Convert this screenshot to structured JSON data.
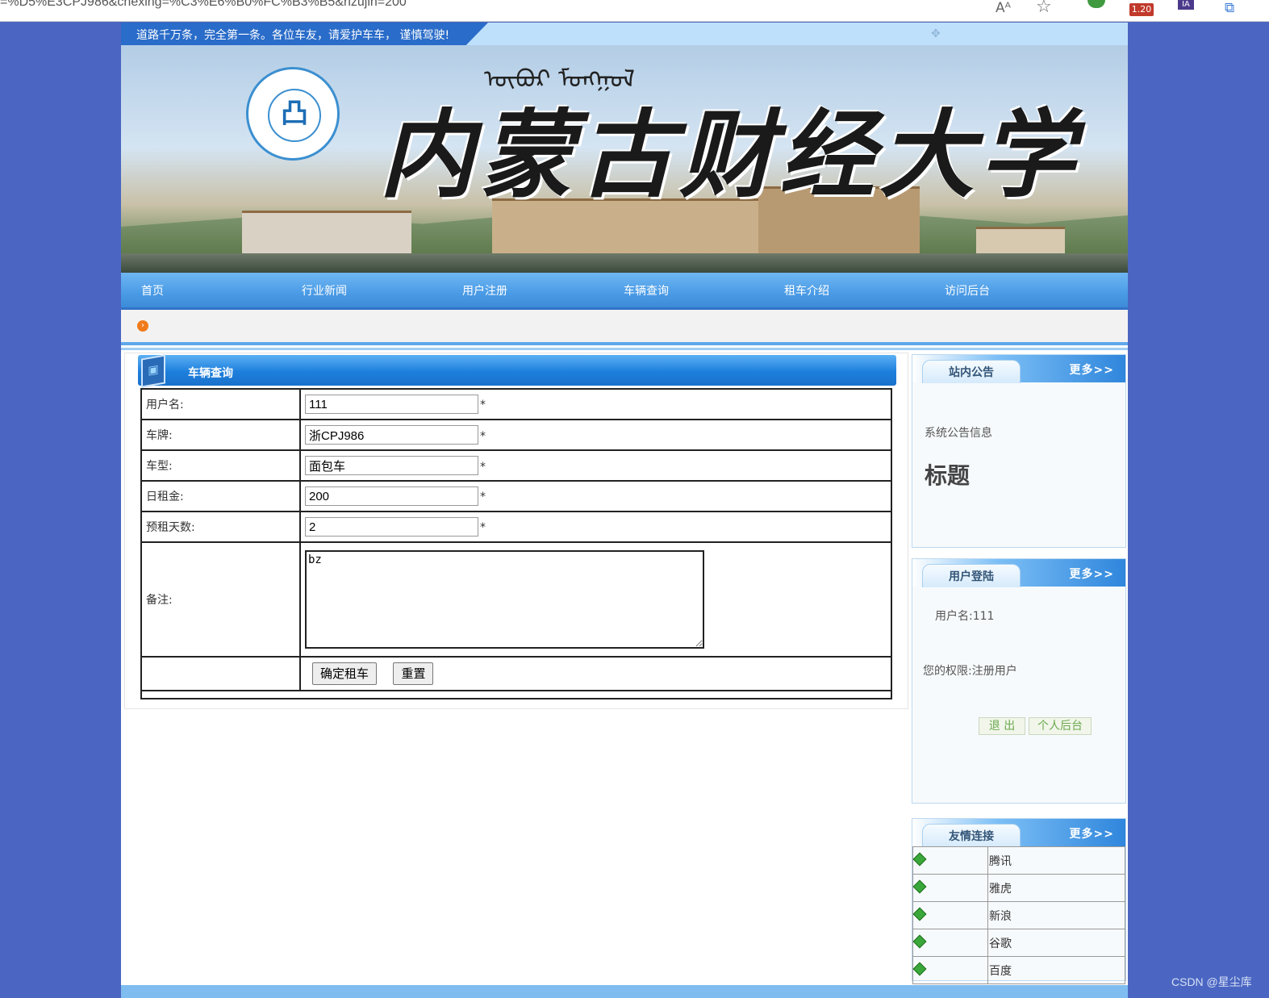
{
  "browser": {
    "url": "=%D5%E3CPJ986&chexing=%C3%E6%B0%FC%B3%B5&rizujin=200",
    "read_aloud_icon": "Aᴬ",
    "favorite_icon": "☆",
    "ext_badge": "1.20",
    "ia_label": "IA"
  },
  "header": {
    "slogan": "道路千万条，完全第一条。各位车友，请爱护车车， 谨慎驾驶!",
    "university_name": "内蒙古财经大学"
  },
  "nav": {
    "items": [
      "首页",
      "行业新闻",
      "用户注册",
      "车辆查询",
      "租车介绍",
      "访问后台"
    ]
  },
  "main": {
    "panel_title": "车辆查询",
    "fields": {
      "username_label": "用户名:",
      "username_value": "111",
      "plate_label": "车牌:",
      "plate_value": "浙CPJ986",
      "type_label": "车型:",
      "type_value": "面包车",
      "daily_rent_label": "日租金:",
      "daily_rent_value": "200",
      "days_label": "预租天数:",
      "days_value": "2",
      "remark_label": "备注:",
      "remark_value": "bz",
      "required_mark": "*"
    },
    "confirm_button": "确定租车",
    "reset_button": "重置"
  },
  "sidebar": {
    "notice": {
      "tab": "站内公告",
      "more": "更多>>",
      "text": "系统公告信息",
      "title": "标题"
    },
    "login": {
      "tab": "用户登陆",
      "more": "更多>>",
      "username": "用户名:111",
      "permission": "您的权限:注册用户",
      "logout_button": "退 出",
      "personal_button": "个人后台"
    },
    "links": {
      "tab": "友情连接",
      "more": "更多>>",
      "items": [
        "腾讯",
        "雅虎",
        "新浪",
        "谷歌",
        "百度"
      ]
    }
  },
  "watermark": "CSDN @星尘库"
}
